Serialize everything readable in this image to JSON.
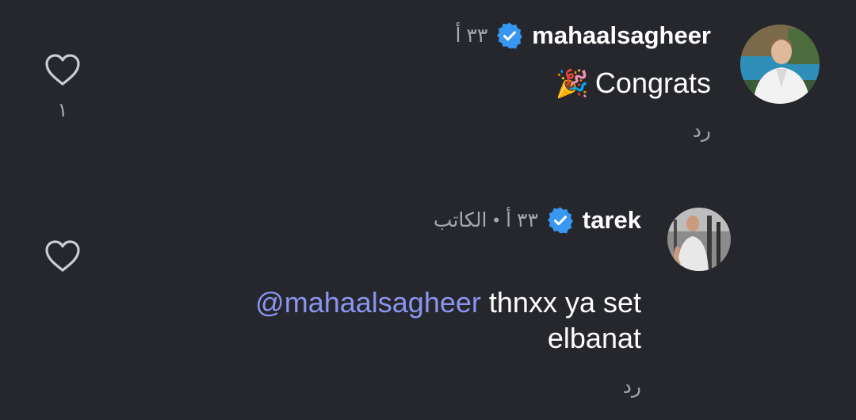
{
  "comments": [
    {
      "username": "mahaalsagheer",
      "verified": true,
      "time": "٣٣ أ",
      "author_tag": "",
      "text": "Congrats",
      "emoji": "🎉",
      "reply_label": "رد",
      "like_count": "١"
    },
    {
      "username": "tarek",
      "verified": true,
      "time": "٣٣ أ",
      "author_tag": "الكاتب",
      "mention": "@mahaalsagheer",
      "text_line1": " thnxx ya set",
      "text_line2": "elbanat",
      "reply_label": "رد",
      "like_count": ""
    }
  ],
  "colors": {
    "background": "#25272c",
    "verified_badge": "#3897f0",
    "mention": "#8a95f0",
    "secondary_text": "#a5a8b0"
  },
  "icons": {
    "verified": "verified-badge-icon",
    "like": "heart-outline-icon"
  }
}
